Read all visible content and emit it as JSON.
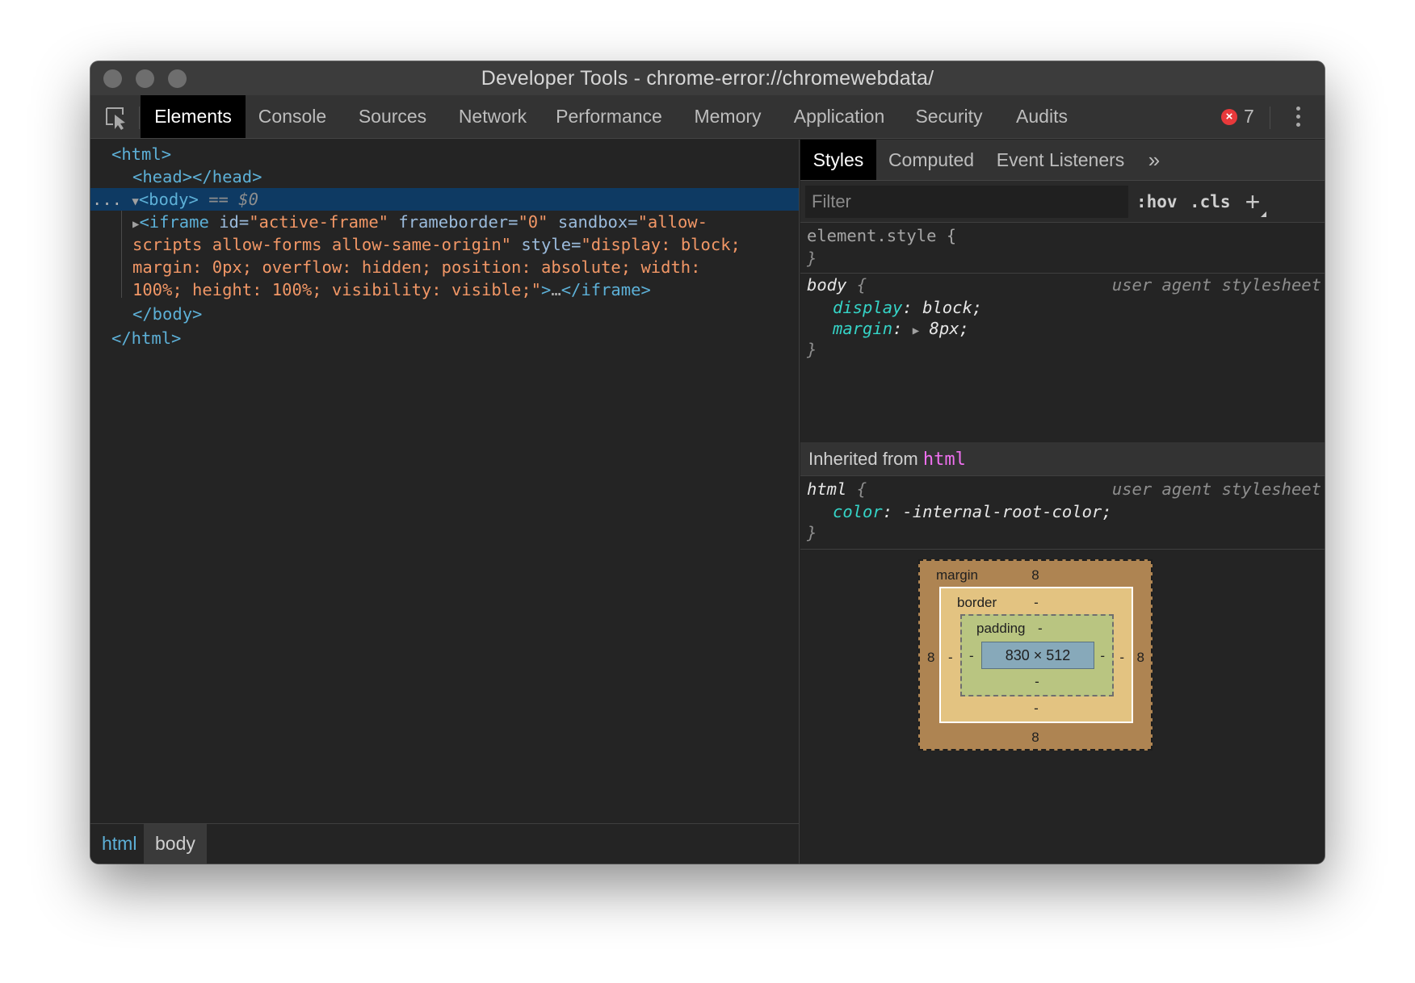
{
  "window": {
    "title": "Developer Tools - chrome-error://chromewebdata/"
  },
  "main_tabs": [
    "Elements",
    "Console",
    "Sources",
    "Network",
    "Performance",
    "Memory",
    "Application",
    "Security",
    "Audits"
  ],
  "errors": {
    "count": "7",
    "icon": "error-x-icon",
    "color": "#e8393b"
  },
  "dom": {
    "html_open": "<html>",
    "head": "<head></head>",
    "body_prefix": "...",
    "body_open": "<body>",
    "body_suffix": " == $0",
    "iframe": {
      "tag_open": "<iframe",
      "attr_id": "id",
      "val_id": "\"active-frame\"",
      "attr_frameborder": "frameborder",
      "val_frameborder": "\"0\"",
      "attr_sandbox": "sandbox",
      "val_sandbox_1": "\"allow-",
      "val_sandbox_2": "scripts allow-forms allow-same-origin\"",
      "attr_style": "style",
      "val_style_1": "\"display: block;",
      "val_style_2": "margin: 0px; overflow: hidden; position: absolute; width:",
      "val_style_3": "100%; height: 100%; visibility: visible;\"",
      "tag_close_open": ">",
      "ellipsis": "…",
      "tag_close": "</iframe>"
    },
    "body_close": "</body>",
    "html_close": "</html>"
  },
  "breadcrumbs": [
    "html",
    "body"
  ],
  "styles_tabs": [
    "Styles",
    "Computed",
    "Event Listeners",
    "»"
  ],
  "filter": {
    "placeholder": "Filter",
    "hov": ":hov",
    "cls": ".cls",
    "add": "+"
  },
  "rules": {
    "element_style": {
      "selector": "element.style {",
      "close": "}"
    },
    "body": {
      "selector": "body",
      "brace_open": " {",
      "source": "user agent stylesheet",
      "props": [
        {
          "name": "display",
          "value": "block;"
        },
        {
          "name": "margin",
          "value": "8px;"
        }
      ],
      "close": "}"
    },
    "inherited_label": "Inherited from",
    "inherited_tag": "html",
    "html": {
      "selector": "html",
      "brace_open": " {",
      "source": "user agent stylesheet",
      "props": [
        {
          "name": "color",
          "value": "-internal-root-color;"
        }
      ],
      "close": "}"
    }
  },
  "box_model": {
    "margin_label": "margin",
    "margin_top": "8",
    "margin_right": "8",
    "margin_bottom": "8",
    "margin_left": "8",
    "border_label": "border",
    "border_top": "-",
    "border_right": "-",
    "border_bottom": "-",
    "border_left": "-",
    "padding_label": "padding",
    "padding_top": "-",
    "padding_right": "-",
    "padding_bottom": "-",
    "padding_left": "-",
    "content": "830 × 512",
    "colors": {
      "margin": "#ae8452",
      "border": "#e3c381",
      "padding": "#b9c581",
      "content": "#87a9ba"
    }
  }
}
